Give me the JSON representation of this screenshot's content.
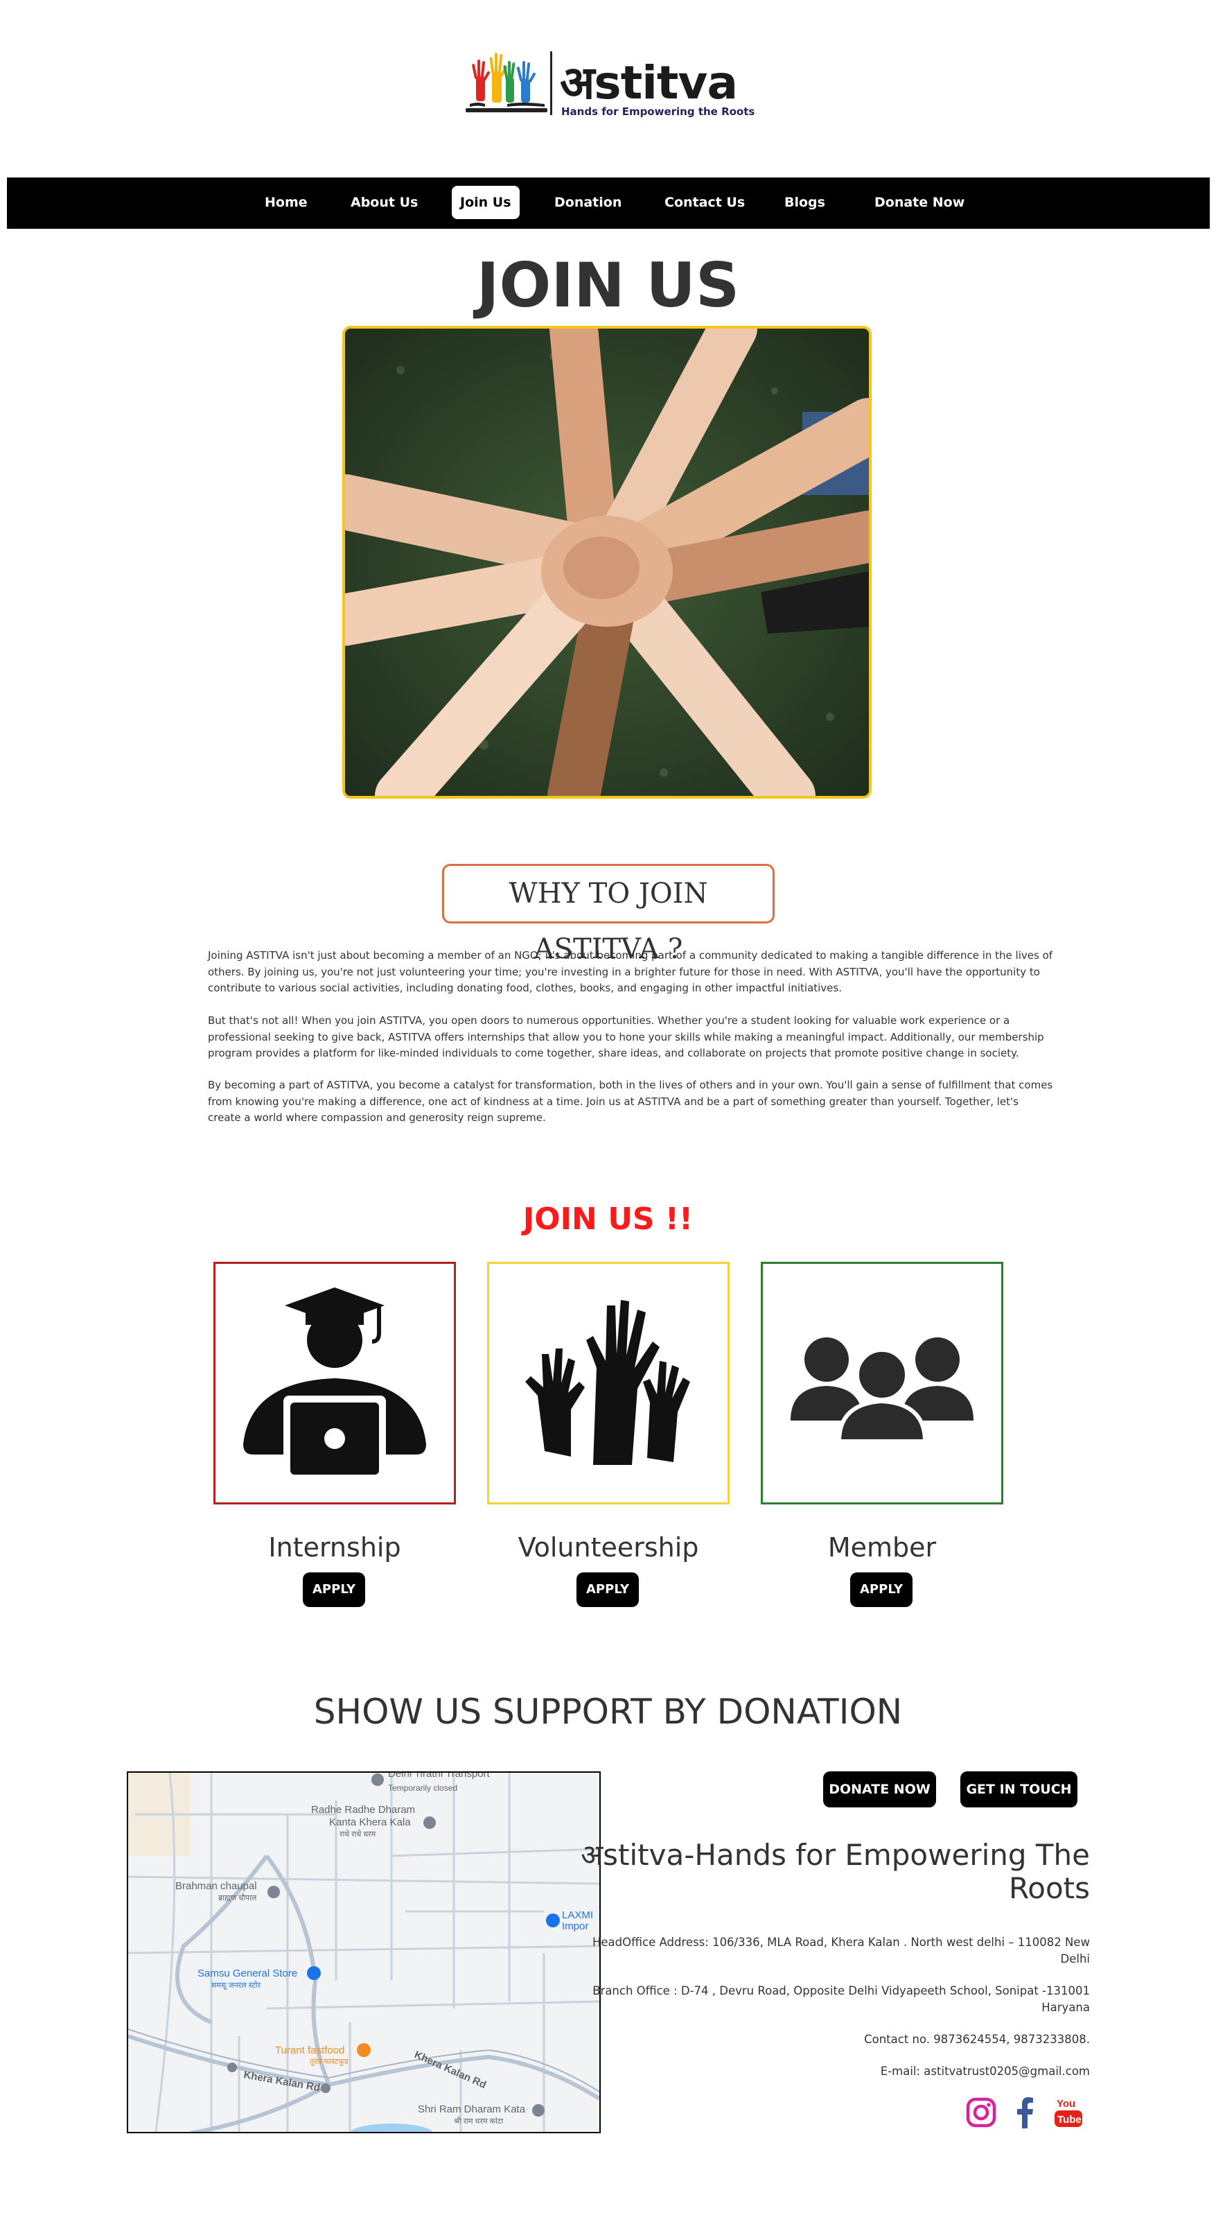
{
  "brand": {
    "name": "अstitva",
    "tagline": "Hands for Empowering the Roots",
    "hand_colors": [
      "#e02424",
      "#f5b50f",
      "#2a9d4a",
      "#2b7bd1"
    ]
  },
  "nav": {
    "items": [
      {
        "label": "Home"
      },
      {
        "label": "About Us"
      },
      {
        "label": "Join Us",
        "active": true
      },
      {
        "label": "Donation"
      },
      {
        "label": "Contact Us"
      },
      {
        "label": "Blogs"
      },
      {
        "label": "Donate Now"
      }
    ]
  },
  "page": {
    "title": "JOIN US",
    "hero_border_color": "#f5c518"
  },
  "why": {
    "heading": "WHY TO JOIN ASTITVA ?",
    "paragraphs": [
      "Joining ASTITVA isn't just about becoming a member of an NGO; it's about becoming part of a community dedicated to making a tangible difference in the lives of others. By joining us, you're not just volunteering your time; you're investing in a brighter future for those in need. With ASTITVA, you'll have the opportunity to contribute to various social activities, including donating food, clothes, books, and engaging in other impactful initiatives.",
      "But that's not all! When you join ASTITVA, you open doors to numerous opportunities. Whether you're a student looking for valuable work experience or a professional seeking to give back, ASTITVA offers internships that allow you to hone your skills while making a meaningful impact. Additionally, our membership program provides a platform for like-minded individuals to come together, share ideas, and collaborate on projects that promote positive change in society.",
      "By becoming a part of ASTITVA, you become a catalyst for transformation, both in the lives of others and in your own. You'll gain a sense of fulfillment that comes from knowing you're making a difference, one act of kindness at a time. Join us at ASTITVA and be a part of something greater than yourself. Together, let's create a world where compassion and generosity reign supreme."
    ]
  },
  "join": {
    "title": "JOIN US !!",
    "title_color": "#ff1a1a",
    "cards": [
      {
        "label": "Internship",
        "button": "APPLY",
        "icon": "student-laptop-icon",
        "border_color": "#b22222"
      },
      {
        "label": "Volunteership",
        "button": "APPLY",
        "icon": "raised-hands-icon",
        "border_color": "#f0d43a"
      },
      {
        "label": "Member",
        "button": "APPLY",
        "icon": "group-icon",
        "border_color": "#2e7d32"
      }
    ]
  },
  "support": {
    "title": "SHOW US SUPPORT BY DONATION",
    "donate_button": "DONATE NOW",
    "contact_button": "GET IN TOUCH",
    "org_name": "अstitva-Hands for Empowering The Roots",
    "head_office": "HeadOffice Address: 106/336, MLA Road, Khera Kalan . North west delhi – 110082 New Delhi",
    "branch_office": "Branch Office : D-74 , Devru Road, Opposite Delhi Vidyapeeth School, Sonipat -131001 Haryana",
    "contact": "Contact no. 9873624554, 9873233808.",
    "email": "E-mail: astitvatrust0205@gmail.com",
    "social": [
      {
        "icon": "instagram-icon",
        "color": "#d6249f"
      },
      {
        "icon": "facebook-icon",
        "color": "#3b5998"
      },
      {
        "icon": "youtube-icon",
        "color": "#e62117"
      }
    ]
  },
  "map": {
    "labels": {
      "transport": "Delhi Tirathi Transport",
      "transport_status": "Temporarily closed",
      "dharam1": "Radhe Radhe Dharam",
      "dharam2": "Kanta Khera Kala",
      "dharam_hi": "राधे राधे धरम",
      "chaupal": "Brahman chaupal",
      "chaupal_hi": "ब्राह्मण चौपाल",
      "laxmi1": "LAXMI",
      "laxmi2": "Impor",
      "samsu": "Samsu General Store",
      "samsu_hi": "समसू जनरल स्टोर",
      "turant": "Turant fastfood",
      "turant_hi": "तुरंत फास्टफूड",
      "road1": "Khera Kalan Rd",
      "road2": "Khera Kalan Rd",
      "shri1": "Shri Ram Dharam Kata",
      "shri_hi": "श्री राम धरम कांटा"
    }
  }
}
